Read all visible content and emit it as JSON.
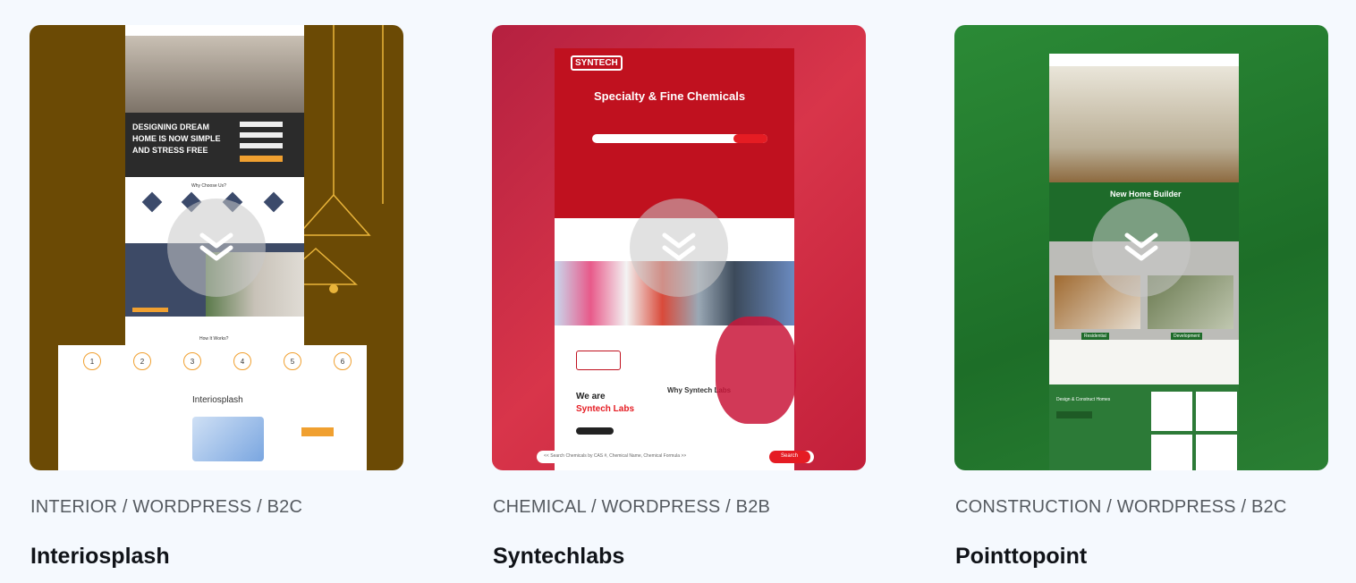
{
  "cards": [
    {
      "category": "INTERIOR / WORDPRESS / B2C",
      "title": "Interiosplash",
      "preview": {
        "hero_text": "DESIGNING DREAM\nHOME IS NOW SIMPLE\nAND STRESS FREE",
        "why_title": "Why Choose Us?",
        "how_title": "How It Works?",
        "steps": [
          "1",
          "2",
          "3",
          "4",
          "5",
          "6"
        ],
        "logo": "Interiosplash",
        "bg": "#6b4a05"
      }
    },
    {
      "category": "CHEMICAL / WORDPRESS / B2B",
      "title": "Syntechlabs",
      "preview": {
        "logo": "SYNTECH",
        "hero_title": "Specialty & Fine Chemicals",
        "we_are": "We are",
        "brand": "Syntech Labs",
        "why": "Why Syntech Labs",
        "search_placeholder": "<< Search Chemicals by CAS #, Chemical Name, Chemical Formula >>",
        "search_btn": "Search",
        "bg": "#c4233c"
      }
    },
    {
      "category": "CONSTRUCTION / WORDPRESS / B2C",
      "title": "Pointtopoint",
      "preview": {
        "hero_title": "New Home Builder",
        "tag1": "Residential",
        "tag2": "Development",
        "section": "Design & Construct Homes",
        "bg": "#1f7a2c"
      }
    }
  ],
  "scroll_icon": "chevron-double-down-icon"
}
